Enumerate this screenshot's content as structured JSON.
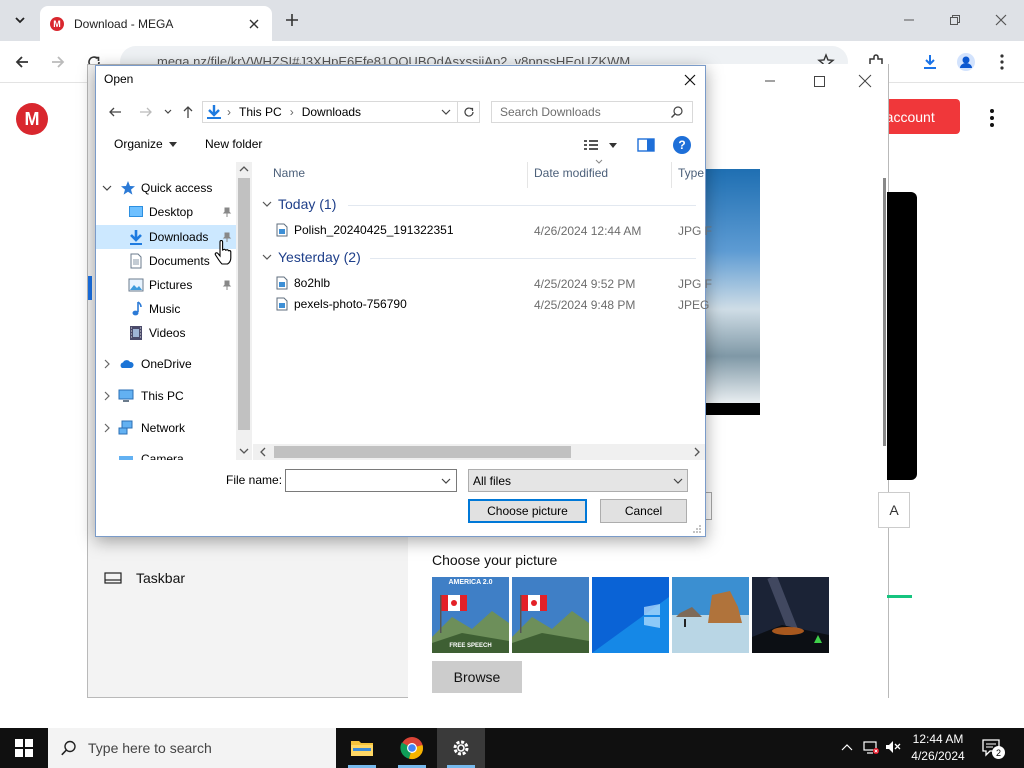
{
  "browser": {
    "tab_title": "Download - MEGA",
    "favicon_letter": "M",
    "url": "mega.nz/file/krVWHZSI#J3XHpE6Efe81OOUBOdAsxssijAp2_v8pnssHEoUZKWM"
  },
  "mega": {
    "logo_letter": "M",
    "create_account": "e account"
  },
  "settings_bg": {
    "taskbar_label": "Taskbar",
    "choose_picture": "Choose your picture",
    "browse": "Browse",
    "side_button": "A",
    "thumb_caption_top": "AMERICA 2.0",
    "thumb_caption_bottom": "FREE SPEECH"
  },
  "dialog": {
    "title": "Open",
    "address": {
      "this_pc": "This PC",
      "folder": "Downloads",
      "sep": "›"
    },
    "search_placeholder": "Search Downloads",
    "organize": "Organize",
    "new_folder": "New folder",
    "help": "?",
    "nav": [
      {
        "label": "Quick access"
      },
      {
        "label": "Desktop"
      },
      {
        "label": "Downloads"
      },
      {
        "label": "Documents"
      },
      {
        "label": "Pictures"
      },
      {
        "label": "Music"
      },
      {
        "label": "Videos"
      },
      {
        "label": "OneDrive"
      },
      {
        "label": "This PC"
      },
      {
        "label": "Network"
      },
      {
        "label": "Camera"
      }
    ],
    "columns": {
      "name": "Name",
      "date": "Date modified",
      "type": "Type"
    },
    "groups": [
      {
        "label": "Today (1)"
      },
      {
        "label": "Yesterday (2)"
      }
    ],
    "files": [
      {
        "name": "Polish_20240425_191322351",
        "date": "4/26/2024 12:44 AM",
        "type": "JPG F"
      },
      {
        "name": "8o2hlb",
        "date": "4/25/2024 9:52 PM",
        "type": "JPG F"
      },
      {
        "name": "pexels-photo-756790",
        "date": "4/25/2024 9:48 PM",
        "type": "JPEG"
      }
    ],
    "file_name_label": "File name:",
    "file_name_value": "",
    "filter": "All files",
    "choose_button": "Choose picture",
    "cancel_button": "Cancel"
  },
  "taskbar": {
    "search_placeholder": "Type here to search",
    "time": "12:44 AM",
    "date": "4/26/2024",
    "notifications": "2"
  },
  "colors": {
    "mega_red": "#d9272e",
    "accent_blue": "#0078d7",
    "selection": "#cce8ff"
  }
}
